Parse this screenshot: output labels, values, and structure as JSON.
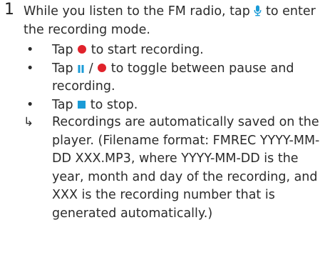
{
  "step": {
    "number": "1",
    "text_before_icon": "While you listen to the FM radio, tap ",
    "text_after_icon": " to enter the recording mode."
  },
  "bullets": [
    {
      "before": "Tap ",
      "after": " to start recording.",
      "icon": "record-icon"
    },
    {
      "before": "Tap ",
      "mid": " / ",
      "after": " to toggle between pause and recording.",
      "icon": "pause-icon"
    },
    {
      "before": "Tap ",
      "after": " to stop.",
      "icon": "stop-icon"
    }
  ],
  "result": {
    "arrow": "↳",
    "text": "Recordings are automatically saved on the player. (Filename format: FMREC YYYY-MM-DD XXX.MP3, where YYYY-MM-DD is the year, month and day of the recording, and XXX is the recording number that is generated automatically.)"
  },
  "bullet_symbol": "•",
  "colors": {
    "record": "#e0222b",
    "pause": "#1a9bd7",
    "stop": "#1a9bd7",
    "mic": "#1a9bd7",
    "text": "#2b2b2b"
  }
}
